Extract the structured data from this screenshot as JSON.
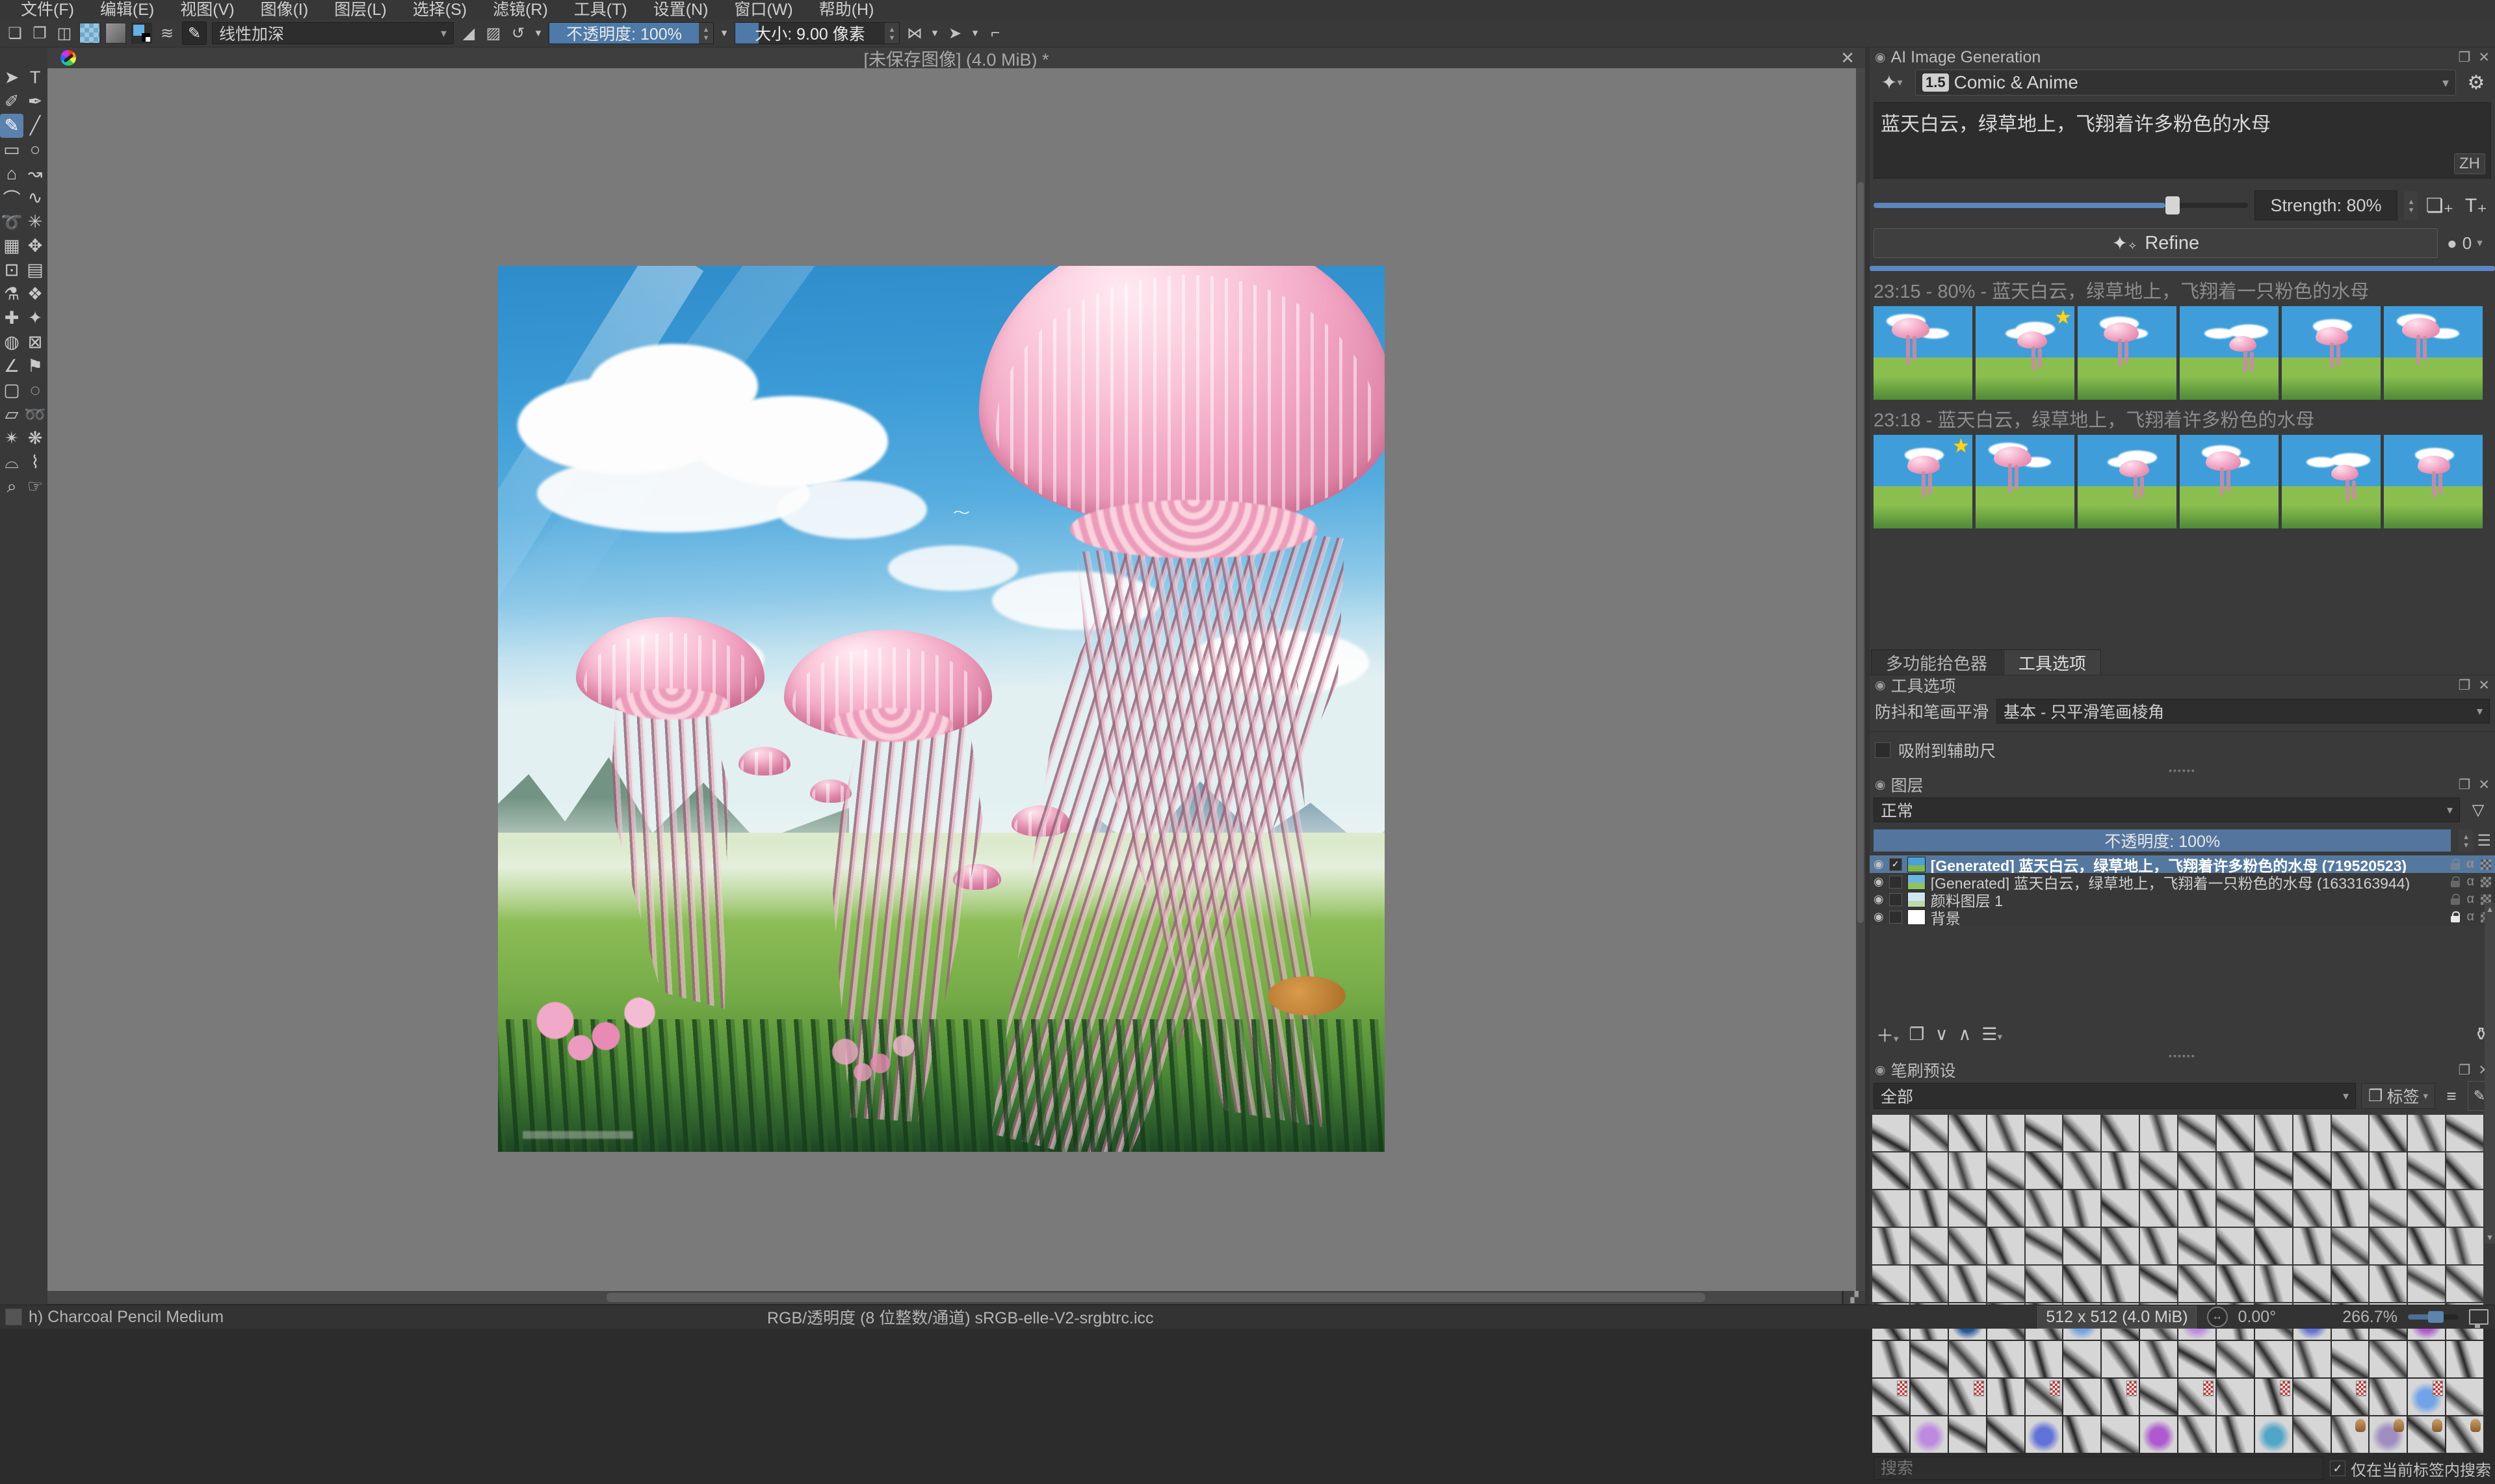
{
  "menu": {
    "items": [
      "文件(F)",
      "编辑(E)",
      "视图(V)",
      "图像(I)",
      "图层(L)",
      "选择(S)",
      "滤镜(R)",
      "工具(T)",
      "设置(N)",
      "窗口(W)",
      "帮助(H)"
    ]
  },
  "toolbar": {
    "blend_mode": "线性加深",
    "opacity_label": "不透明度:  100%",
    "size_label": "大小:  9.00 像素"
  },
  "document": {
    "title": "[未保存图像]  (4.0 MiB) *"
  },
  "ai_panel": {
    "title": "AI Image Generation",
    "style_badge": "1.5",
    "style_preset": "Comic & Anime",
    "prompt": "蓝天白云，绿草地上，飞翔着许多粉色的水母",
    "lang_badge": "ZH",
    "strength_label": "Strength: 80%",
    "refine_label": "Refine",
    "queue_count": "0",
    "history": [
      {
        "header": "23:15 - 80% - 蓝天白云，绿草地上，飞翔着一只粉色的水母",
        "count": 6,
        "starred_index": 1
      },
      {
        "header": "23:18 - 蓝天白云，绿草地上，飞翔着许多粉色的水母",
        "count": 6,
        "starred_index": 0
      }
    ]
  },
  "tool_options": {
    "tab_color_selector": "多功能拾色器",
    "tab_tool_options": "工具选项",
    "docker_title": "工具选项",
    "smoothing_label": "防抖和笔画平滑",
    "smoothing_value": "基本 - 只平滑笔画棱角",
    "snap_checkbox_label": "吸附到辅助尺"
  },
  "layers": {
    "docker_title": "图层",
    "blend_mode": "正常",
    "opacity_label": "不透明度:  100%",
    "rows": [
      {
        "name": "[Generated] 蓝天白云，绿草地上，飞翔着许多粉色的水母 (719520523)",
        "selected": true,
        "checked": true,
        "locked": false,
        "thumb": "linear-gradient(180deg,#4aa0d8 55%,#7fb94e 55%)"
      },
      {
        "name": "[Generated] 蓝天白云，绿草地上，飞翔着一只粉色的水母 (1633163944)",
        "selected": false,
        "checked": false,
        "locked": false,
        "thumb": "linear-gradient(180deg,#6db5e2 55%,#8fc45c 55%)"
      },
      {
        "name": "颜料图层 1",
        "selected": false,
        "checked": false,
        "locked": false,
        "thumb": "linear-gradient(180deg,#cfe6f2 60%,#bcd9a8 60%)"
      },
      {
        "name": "背景",
        "selected": false,
        "checked": false,
        "locked": true,
        "thumb": "#ffffff"
      }
    ]
  },
  "brushes": {
    "docker_title": "笔刷预设",
    "filter_value": "全部",
    "tag_label": "标签",
    "search_placeholder": "搜索",
    "search_checkbox_label": "仅在当前标签内搜索",
    "grid": {
      "cols": 16,
      "rows": 9
    }
  },
  "statusbar": {
    "brush_name": "h) Charcoal Pencil Medium",
    "color_profile": "RGB/透明度 (8 位整数/通道)  sRGB-elle-V2-srgbtrc.icc",
    "dimensions": "512 x 512 (4.0 MiB)",
    "angle": "0.00°",
    "zoom": "266.7%"
  },
  "icons": {
    "close": "✕",
    "float": "❐",
    "docker_lock": "◉",
    "dropdown": "▾",
    "spin_up": "▴",
    "spin_down": "▾",
    "gear": "⚙",
    "magic": "✦",
    "eye": "◉",
    "alpha": "α",
    "funnel": "▽",
    "menu": "≡",
    "plus": "＋",
    "duplicate": "❐",
    "down": "∨",
    "up": "∧",
    "props": "☰",
    "trash": "⚱",
    "tag": "❒",
    "scroll_up": "▲",
    "scroll_down": "▼",
    "mirror_h": "⋈",
    "mirror_v": "➤",
    "wrap": "⌐",
    "reload": "↺",
    "eraser": "◢",
    "checker": "▨",
    "new_doc": "❏",
    "open_doc": "❐",
    "save_doc": "◫",
    "star": "★",
    "add_layer_btn": "❏₊",
    "add_text_btn": "T₊",
    "queue_dot": "●",
    "angle_arrows": "↔",
    "corner": "▞",
    "stroke_list": "≋"
  },
  "toolbox": {
    "tools": [
      {
        "name": "select-shapes-tool",
        "glyph": "➤",
        "selected": false
      },
      {
        "name": "text-tool",
        "glyph": "T",
        "selected": false
      },
      {
        "name": "edit-shapes-tool",
        "glyph": "✐",
        "selected": false
      },
      {
        "name": "calligraphy-tool",
        "glyph": "✒",
        "selected": false
      },
      {
        "name": "freehand-brush-tool",
        "glyph": "✎",
        "selected": true
      },
      {
        "name": "line-tool",
        "glyph": "╱",
        "selected": false
      },
      {
        "name": "rectangle-tool",
        "glyph": "▭",
        "selected": false
      },
      {
        "name": "ellipse-tool",
        "glyph": "○",
        "selected": false
      },
      {
        "name": "polygon-tool",
        "glyph": "⌂",
        "selected": false
      },
      {
        "name": "polyline-tool",
        "glyph": "↝",
        "selected": false
      },
      {
        "name": "bezier-curve-tool",
        "glyph": "⌒",
        "selected": false
      },
      {
        "name": "freehand-path-tool",
        "glyph": "∿",
        "selected": false
      },
      {
        "name": "dynamic-brush-tool",
        "glyph": "➰",
        "selected": false
      },
      {
        "name": "multibrush-tool",
        "glyph": "✳",
        "selected": false
      },
      {
        "name": "transform-tool",
        "glyph": "▦",
        "selected": false
      },
      {
        "name": "move-tool",
        "glyph": "✥",
        "selected": false
      },
      {
        "name": "crop-tool",
        "glyph": "⊡",
        "selected": false
      },
      {
        "name": "gradient-tool",
        "glyph": "▤",
        "selected": false
      },
      {
        "name": "color-picker-tool",
        "glyph": "⚗",
        "selected": false
      },
      {
        "name": "pattern-edit-tool",
        "glyph": "❖",
        "selected": false
      },
      {
        "name": "smart-patch-tool",
        "glyph": "✚",
        "selected": false
      },
      {
        "name": "fill-tool",
        "glyph": "✦",
        "selected": false
      },
      {
        "name": "enclose-fill-tool",
        "glyph": "◍",
        "selected": false
      },
      {
        "name": "assistants-tool",
        "glyph": "⊠",
        "selected": false
      },
      {
        "name": "measure-tool",
        "glyph": "∠",
        "selected": false
      },
      {
        "name": "reference-images-tool",
        "glyph": "⚑",
        "selected": false
      },
      {
        "name": "rect-select-tool",
        "glyph": "▢",
        "selected": false
      },
      {
        "name": "ellipse-select-tool",
        "glyph": "◌",
        "selected": false
      },
      {
        "name": "polygon-select-tool",
        "glyph": "▱",
        "selected": false
      },
      {
        "name": "freehand-select-tool",
        "glyph": "➿",
        "selected": false
      },
      {
        "name": "magic-wand-select-tool",
        "glyph": "✴",
        "selected": false
      },
      {
        "name": "similar-color-select-tool",
        "glyph": "❋",
        "selected": false
      },
      {
        "name": "bezier-select-tool",
        "glyph": "⌓",
        "selected": false
      },
      {
        "name": "magnetic-select-tool",
        "glyph": "⌇",
        "selected": false
      },
      {
        "name": "zoom-tool",
        "glyph": "⌕",
        "selected": false
      },
      {
        "name": "pan-tool",
        "glyph": "☞",
        "selected": false
      }
    ]
  },
  "colors": {
    "accent_blue": "#557fae",
    "progress_blue": "#5b87c6",
    "selected_layer": "#55789f",
    "star_yellow": "#ffd21e",
    "canvas_surround": "#7a7a7a"
  }
}
